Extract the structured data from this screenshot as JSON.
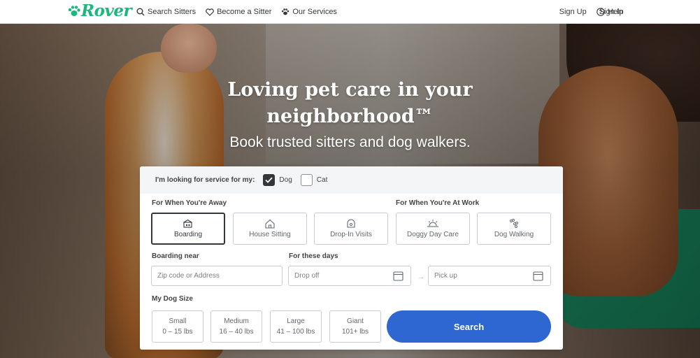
{
  "header": {
    "logo_text": "Rover",
    "nav_left": [
      {
        "label": "Search Sitters",
        "icon": "search-icon"
      },
      {
        "label": "Become a Sitter",
        "icon": "heart-icon"
      },
      {
        "label": "Our Services",
        "icon": "services-icon"
      }
    ],
    "sign_up": "Sign Up",
    "sign_in": "Sign In",
    "help": "Help"
  },
  "hero": {
    "headline_line1": "Loving pet care in your",
    "headline_line2": "neighborhood™",
    "subheadline": "Book trusted sitters and dog walkers."
  },
  "search": {
    "pet_prompt": "I'm looking for service for my:",
    "pets": [
      {
        "label": "Dog",
        "checked": true
      },
      {
        "label": "Cat",
        "checked": false
      }
    ],
    "away_heading": "For When You're Away",
    "work_heading": "For When You're At Work",
    "services": [
      {
        "label": "Boarding",
        "icon": "boarding-icon",
        "selected": true
      },
      {
        "label": "House Sitting",
        "icon": "house-sitting-icon",
        "selected": false
      },
      {
        "label": "Drop-In Visits",
        "icon": "drop-in-icon",
        "selected": false
      },
      {
        "label": "Doggy Day Care",
        "icon": "sun-icon",
        "selected": false
      },
      {
        "label": "Dog Walking",
        "icon": "paw-walking-icon",
        "selected": false
      }
    ],
    "location_label": "Boarding near",
    "location_placeholder": "Zip code or Address",
    "dates_label": "For these days",
    "dropoff_placeholder": "Drop off",
    "pickup_placeholder": "Pick up",
    "arrow": "→",
    "size_label": "My Dog Size",
    "sizes": [
      {
        "name": "Small",
        "range": "0 – 15 lbs"
      },
      {
        "name": "Medium",
        "range": "16 – 40 lbs"
      },
      {
        "name": "Large",
        "range": "41 – 100 lbs"
      },
      {
        "name": "Giant",
        "range": "101+ lbs"
      }
    ],
    "search_button": "Search"
  },
  "colors": {
    "brand_green": "#1bb87c",
    "search_blue": "#2e67d1",
    "text_dark": "#404347"
  }
}
